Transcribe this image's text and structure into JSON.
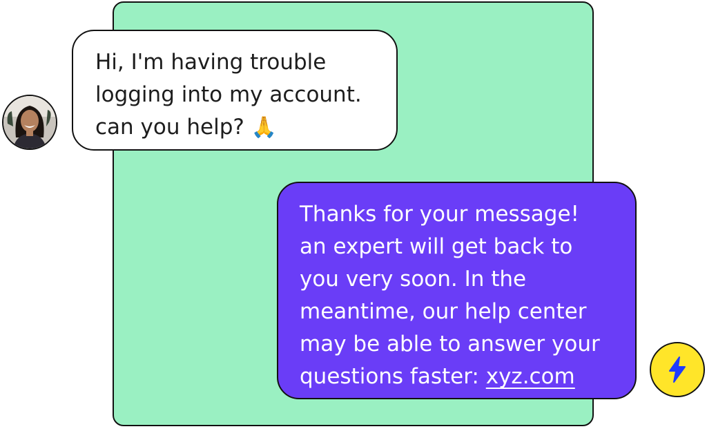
{
  "colors": {
    "panel_background": "#9af0c2",
    "user_bubble_background": "#ffffff",
    "agent_bubble_background": "#6a3df7",
    "badge_background": "#ffe529",
    "bolt_color": "#1f3bff",
    "outline": "#111111"
  },
  "user_message": {
    "lines": [
      "Hi, I'm having trouble",
      "logging into my account.",
      "can you help?"
    ],
    "emoji": "🙏",
    "avatar_icon": "user-photo-avatar"
  },
  "agent_message": {
    "lines": [
      "Thanks for your message!",
      "an expert will get back to",
      "you very soon. In the",
      "meantime, our help center",
      "may be able to answer your",
      "questions faster:"
    ],
    "link_text": "xyz.com",
    "badge_icon": "lightning-bolt-icon"
  }
}
